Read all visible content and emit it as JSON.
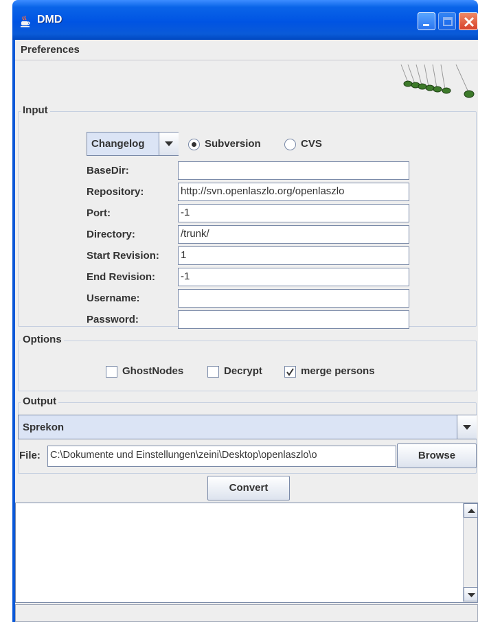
{
  "window": {
    "title": "DMD",
    "icon": "java-cup-icon"
  },
  "menu": {
    "items": [
      "Preferences"
    ]
  },
  "input": {
    "legend": "Input",
    "mode": {
      "selected": "Changelog"
    },
    "vcs": {
      "options": [
        "Subversion",
        "CVS"
      ],
      "selected": "Subversion"
    },
    "fields": [
      {
        "label": "BaseDir:",
        "value": ""
      },
      {
        "label": "Repository:",
        "value": "http://svn.openlaszlo.org/openlaszlo"
      },
      {
        "label": "Port:",
        "value": "-1"
      },
      {
        "label": "Directory:",
        "value": "/trunk/"
      },
      {
        "label": "Start Revision:",
        "value": "1"
      },
      {
        "label": "End Revision:",
        "value": "-1"
      },
      {
        "label": "Username:",
        "value": ""
      },
      {
        "label": "Password:",
        "value": ""
      }
    ]
  },
  "options": {
    "legend": "Options",
    "checkboxes": [
      {
        "label": "GhostNodes",
        "checked": false
      },
      {
        "label": "Decrypt",
        "checked": false
      },
      {
        "label": "merge persons",
        "checked": true
      }
    ]
  },
  "output": {
    "legend": "Output",
    "format": {
      "selected": "Sprekon"
    },
    "file_label": "File:",
    "file_value": "C:\\Dokumente und Einstellungen\\zeini\\Desktop\\openlaszlo\\o",
    "browse_label": "Browse"
  },
  "convert_label": "Convert",
  "log": {
    "text": ""
  },
  "colors": {
    "titlebar": "#0054e3",
    "panel": "#eeeeee",
    "border": "#7a8aa8",
    "close": "#d6402a"
  }
}
